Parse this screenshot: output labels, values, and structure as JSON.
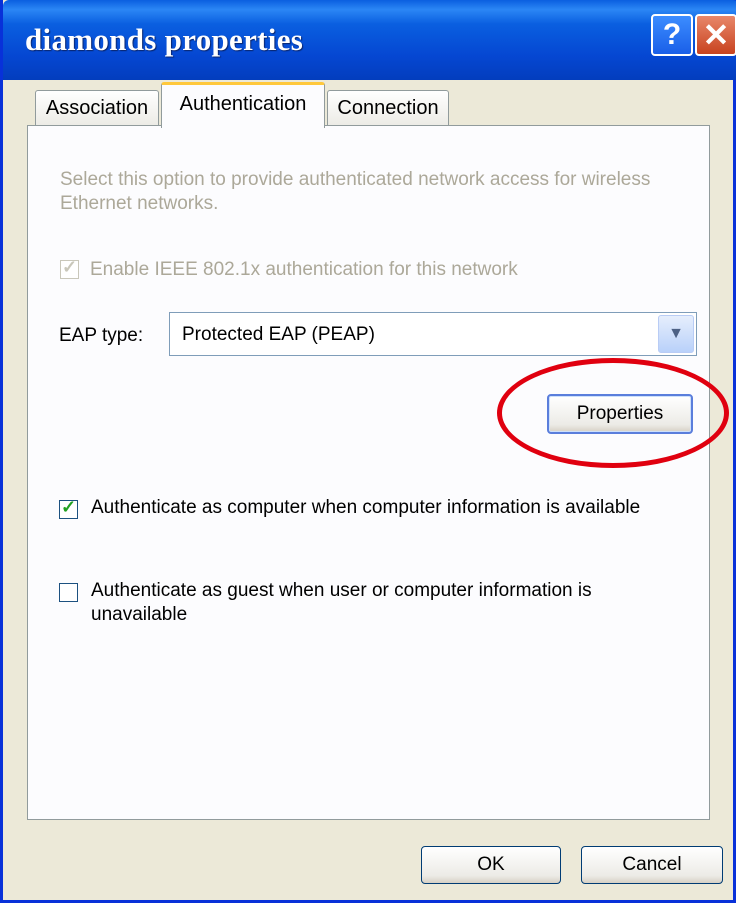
{
  "window": {
    "title": "diamonds properties",
    "help_glyph": "?",
    "close_glyph": "✕"
  },
  "tabs": [
    {
      "label": "Association",
      "active": false
    },
    {
      "label": "Authentication",
      "active": true
    },
    {
      "label": "Connection",
      "active": false
    }
  ],
  "auth": {
    "description": "Select this option to provide authenticated network access for wireless Ethernet networks.",
    "enable_8021x": {
      "label": "Enable IEEE 802.1x authentication for this network",
      "checked": true,
      "disabled": true
    },
    "eap_type_label": "EAP type:",
    "eap_type_value": "Protected EAP (PEAP)",
    "properties_button": "Properties",
    "auth_as_computer": {
      "label": "Authenticate as computer when computer information is available",
      "checked": true
    },
    "auth_as_guest": {
      "label": "Authenticate as guest when user or computer information is unavailable",
      "checked": false
    }
  },
  "buttons": {
    "ok": "OK",
    "cancel": "Cancel"
  },
  "annotation": {
    "color": "#e0000f",
    "shape": "ellipse-around-properties-button"
  }
}
